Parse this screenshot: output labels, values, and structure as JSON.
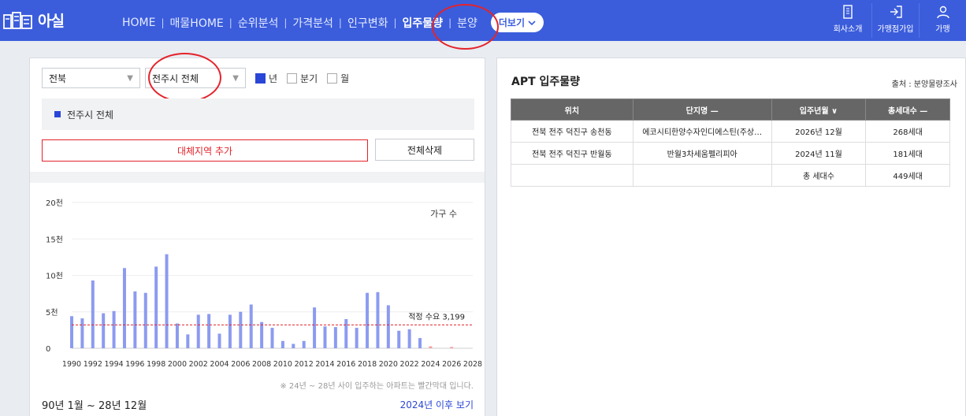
{
  "header": {
    "logo_text": "아실",
    "nav": [
      "HOME",
      "매물HOME",
      "순위분석",
      "가격분석",
      "인구변화",
      "입주물량",
      "분양"
    ],
    "active_nav": "입주물량",
    "more_label": "더보기",
    "right_menu": [
      {
        "label": "회사소개",
        "icon": "building-icon"
      },
      {
        "label": "가맹점가입",
        "icon": "login-icon"
      },
      {
        "label": "가맹",
        "icon": "person-icon"
      }
    ]
  },
  "filters": {
    "province": "전북",
    "city": "전주시 전체",
    "period_options": [
      {
        "label": "년",
        "checked": true
      },
      {
        "label": "분기",
        "checked": false
      },
      {
        "label": "월",
        "checked": false
      }
    ]
  },
  "region_tag": "전주시 전체",
  "buttons": {
    "add_region": "대체지역 추가",
    "delete_all": "전체삭제"
  },
  "chart_data": {
    "type": "bar",
    "legend": "가구 수",
    "yticks": [
      "20천",
      "15천",
      "10천",
      "5천",
      "0"
    ],
    "ylim": [
      0,
      20000
    ],
    "x": [
      1990,
      1991,
      1992,
      1993,
      1994,
      1995,
      1996,
      1997,
      1998,
      1999,
      2000,
      2001,
      2002,
      2003,
      2004,
      2005,
      2006,
      2007,
      2008,
      2009,
      2010,
      2011,
      2012,
      2013,
      2014,
      2015,
      2016,
      2017,
      2018,
      2019,
      2020,
      2021,
      2022,
      2023,
      2024,
      2025,
      2026,
      2027,
      2028
    ],
    "xticks": [
      "1990",
      "1992",
      "1994",
      "1996",
      "1998",
      "2000",
      "2002",
      "2004",
      "2006",
      "2008",
      "2010",
      "2012",
      "2014",
      "2016",
      "2018",
      "2020",
      "2022",
      "2024",
      "2026",
      "2028"
    ],
    "values": [
      4400,
      4100,
      9300,
      4800,
      5100,
      11000,
      7800,
      7600,
      11200,
      12900,
      3400,
      1900,
      4600,
      4700,
      2000,
      4600,
      5000,
      6000,
      3600,
      2800,
      1000,
      600,
      1000,
      5600,
      3000,
      2900,
      4000,
      2800,
      7600,
      7700,
      5900,
      2400,
      2600,
      1400,
      268,
      0,
      181,
      0,
      0
    ],
    "future_from": 2024,
    "bar_color": "#8c9bf0",
    "future_color": "#f3a0a0",
    "reference_line": {
      "label": "적정 수요 3,199",
      "value": 3199,
      "color": "#e4232b"
    }
  },
  "chart_note": "※ 24년 ~ 28년 사이 입주하는 아파트는 빨간막대 입니다.",
  "period_label": "90년 1월 ~ 28년 12월",
  "more_link": "2024년 이후 보기",
  "supply_table": {
    "title": "APT 입주물량",
    "source": "출처 : 분양물량조사",
    "columns": [
      "위치",
      "단지명 —",
      "입주년월 ∨",
      "총세대수 —"
    ],
    "rows": [
      [
        "전북 전주 덕진구 송천동",
        "에코시티한양수자인디에스틴(주상…",
        "2026년 12월",
        "268세대"
      ],
      [
        "전북 전주 덕진구 반월동",
        "반월3차세움펠리피아",
        "2024년 11월",
        "181세대"
      ],
      [
        "",
        "",
        "총 세대수",
        "449세대"
      ]
    ]
  }
}
